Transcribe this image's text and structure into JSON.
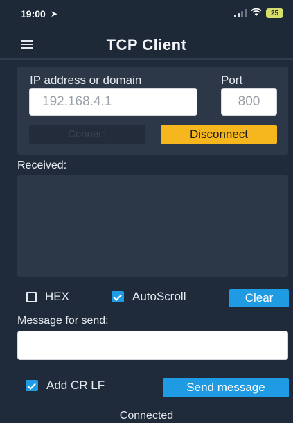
{
  "status_bar": {
    "time": "19:00",
    "location_icon": "location-arrow-icon",
    "wifi_icon": "wifi-icon",
    "battery": "25"
  },
  "header": {
    "title": "TCP Client",
    "menu_icon": "hamburger-menu-icon"
  },
  "connection": {
    "ip_label": "IP address or domain",
    "ip_value": "192.168.4.1",
    "port_label": "Port",
    "port_value": "800",
    "connect_label": "Connect",
    "disconnect_label": "Disconnect"
  },
  "received": {
    "label": "Received:"
  },
  "options": {
    "hex_label": "HEX",
    "hex_checked": false,
    "autoscroll_label": "AutoScroll",
    "autoscroll_checked": true,
    "clear_label": "Clear"
  },
  "message": {
    "label": "Message for send:",
    "value": "",
    "crlf_label": "Add CR LF",
    "crlf_checked": true,
    "send_label": "Send message"
  },
  "footer": {
    "status": "Connected"
  },
  "colors": {
    "background": "#1f2a3a",
    "panel": "#2c3748",
    "accent_blue": "#1f9be4",
    "accent_yellow": "#f5b71d",
    "battery": "#d7dd6a"
  }
}
